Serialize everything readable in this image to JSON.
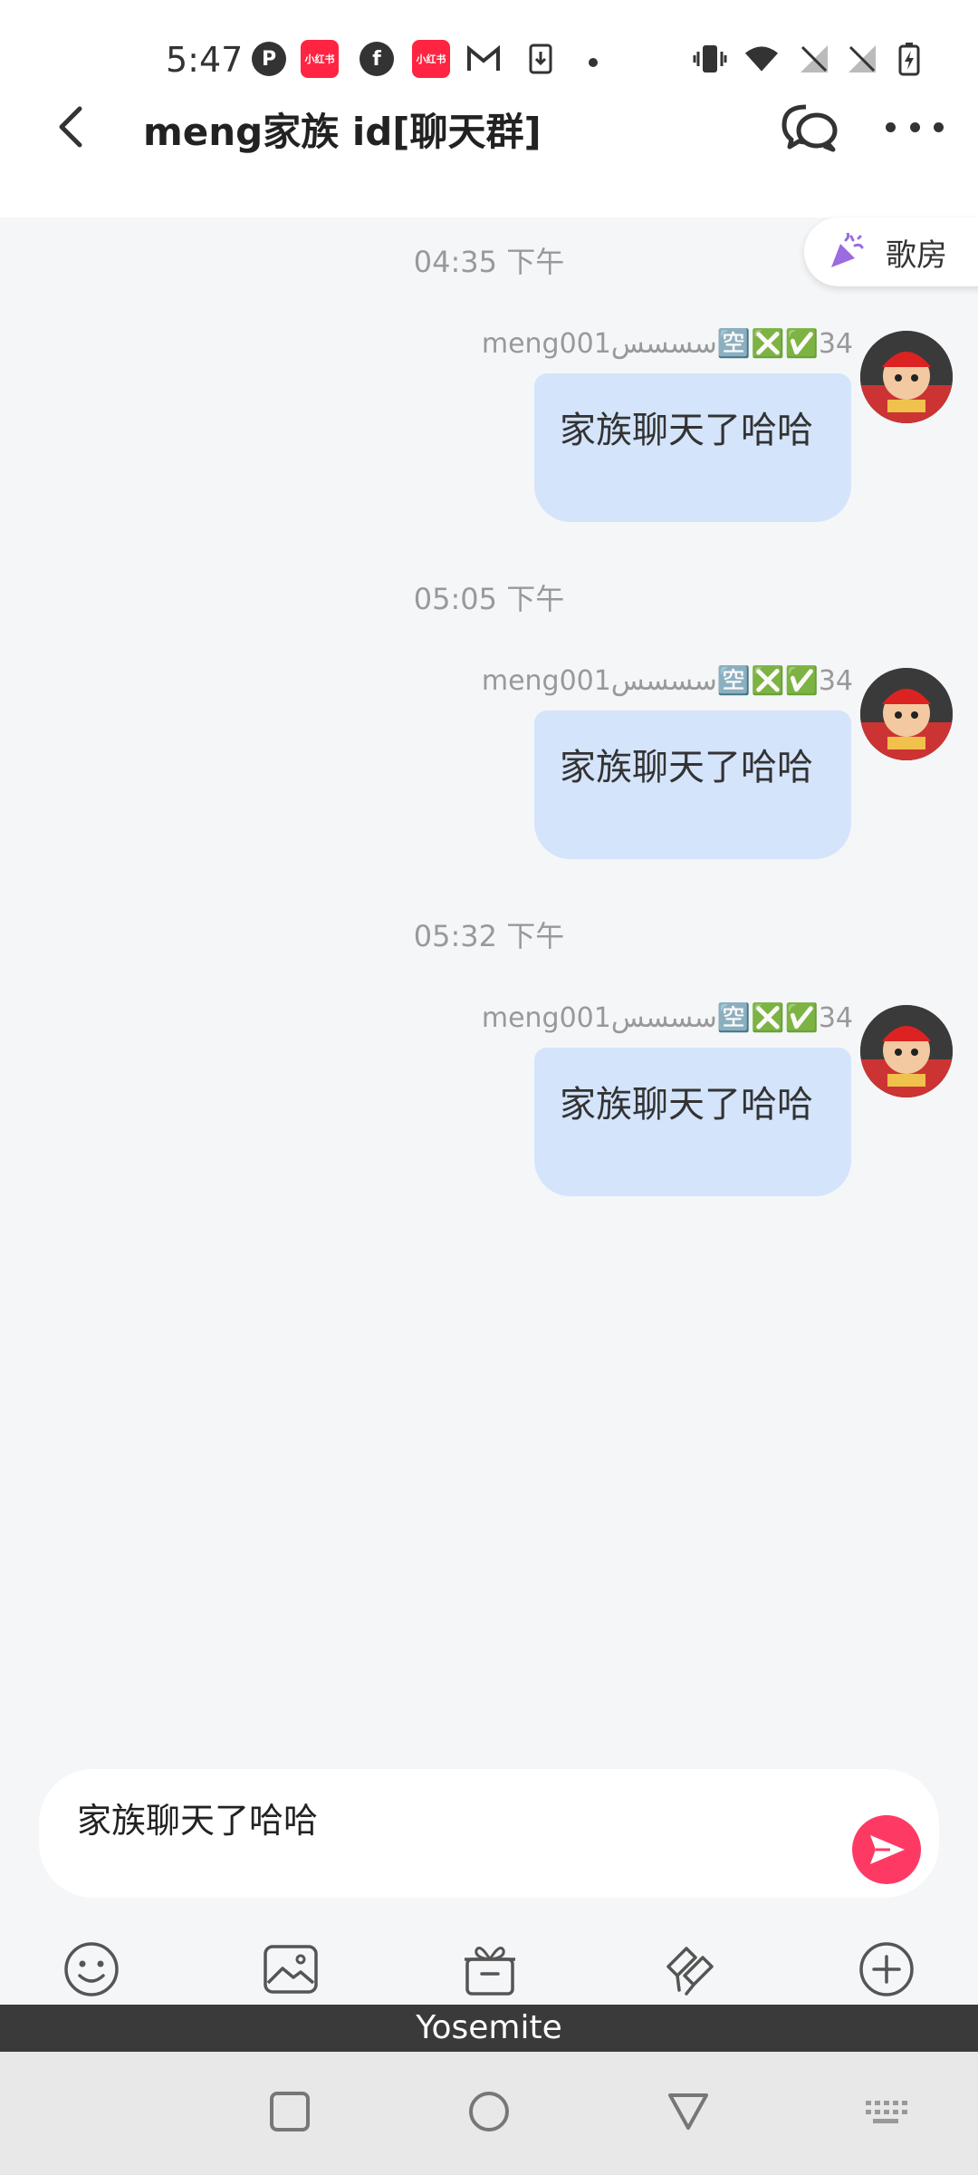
{
  "status_bar": {
    "time": "5:47",
    "icons": [
      "p-app-icon",
      "xiaohongshu-icon",
      "facebook-icon",
      "xiaohongshu-icon",
      "gmail-icon",
      "download-icon",
      "dot",
      "vibrate-icon",
      "wifi-icon",
      "no-sim-icon",
      "no-sim-icon",
      "battery-charging-icon"
    ],
    "xhs_label": "小红书",
    "facebook_glyph": "f"
  },
  "header": {
    "title": "meng家族 id[聊天群]"
  },
  "song_room": {
    "label": "歌房"
  },
  "messages": [
    {
      "timestamp": "04:35 下午",
      "sender": "meng001سسسس🈳❎✅34",
      "text": "家族聊天了哈哈"
    },
    {
      "timestamp": "05:05 下午",
      "sender": "meng001سسسس🈳❎✅34",
      "text": "家族聊天了哈哈"
    },
    {
      "timestamp": "05:32 下午",
      "sender": "meng001سسسس🈳❎✅34",
      "text": "家族聊天了哈哈"
    }
  ],
  "input": {
    "value": "家族聊天了哈哈"
  },
  "toolbar": {
    "icons": [
      "emoji-icon",
      "image-icon",
      "gift-icon",
      "dice-icon",
      "plus-icon"
    ]
  },
  "keyboard": {
    "label": "Yosemite"
  },
  "colors": {
    "accent": "#fe3a64",
    "bubble": "#d4e4fb",
    "background": "#f5f6f8"
  }
}
